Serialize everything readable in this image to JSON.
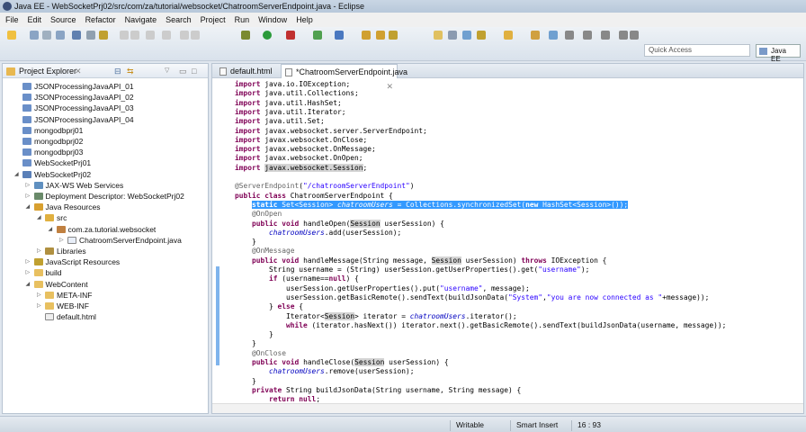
{
  "window": {
    "title": "Java EE - WebSocketPrj02/src/com/za/tutorial/websocket/ChatroomServerEndpoint.java - Eclipse"
  },
  "menu": [
    "File",
    "Edit",
    "Source",
    "Refactor",
    "Navigate",
    "Search",
    "Project",
    "Run",
    "Window",
    "Help"
  ],
  "toolbar": {
    "quick_access_placeholder": "Quick Access",
    "perspective": "Java EE"
  },
  "explorer": {
    "title": "Project Explorer",
    "items": [
      {
        "label": "JSONProcessingJavaAPI_01",
        "depth": 0,
        "icon": "project-folder-icon",
        "twisty": ""
      },
      {
        "label": "JSONProcessingJavaAPI_02",
        "depth": 0,
        "icon": "project-folder-icon",
        "twisty": ""
      },
      {
        "label": "JSONProcessingJavaAPI_03",
        "depth": 0,
        "icon": "project-folder-icon",
        "twisty": ""
      },
      {
        "label": "JSONProcessingJavaAPI_04",
        "depth": 0,
        "icon": "project-folder-icon",
        "twisty": ""
      },
      {
        "label": "mongodbprj01",
        "depth": 0,
        "icon": "project-folder-icon",
        "twisty": ""
      },
      {
        "label": "mongodbprj02",
        "depth": 0,
        "icon": "project-folder-icon",
        "twisty": ""
      },
      {
        "label": "mongodbprj03",
        "depth": 0,
        "icon": "project-folder-icon",
        "twisty": ""
      },
      {
        "label": "WebSocketPrj01",
        "depth": 0,
        "icon": "project-folder-icon",
        "twisty": ""
      },
      {
        "label": "WebSocketPrj02",
        "depth": 0,
        "icon": "web-project-icon",
        "twisty": "open"
      },
      {
        "label": "JAX-WS Web Services",
        "depth": 1,
        "icon": "web-services-icon",
        "twisty": "closed"
      },
      {
        "label": "Deployment Descriptor: WebSocketPrj02",
        "depth": 1,
        "icon": "deployment-descriptor-icon",
        "twisty": "closed"
      },
      {
        "label": "Java Resources",
        "depth": 1,
        "icon": "java-resources-icon",
        "twisty": "open"
      },
      {
        "label": "src",
        "depth": 2,
        "icon": "source-folder-icon",
        "twisty": "open"
      },
      {
        "label": "com.za.tutorial.websocket",
        "depth": 3,
        "icon": "package-icon",
        "twisty": "open"
      },
      {
        "label": "ChatroomServerEndpoint.java",
        "depth": 4,
        "icon": "java-file-icon",
        "twisty": "closed"
      },
      {
        "label": "Libraries",
        "depth": 2,
        "icon": "libraries-icon",
        "twisty": "closed"
      },
      {
        "label": "JavaScript Resources",
        "depth": 1,
        "icon": "javascript-resources-icon",
        "twisty": "closed"
      },
      {
        "label": "build",
        "depth": 1,
        "icon": "folder-icon",
        "twisty": "closed"
      },
      {
        "label": "WebContent",
        "depth": 1,
        "icon": "folder-icon",
        "twisty": "open"
      },
      {
        "label": "META-INF",
        "depth": 2,
        "icon": "folder-icon",
        "twisty": "closed"
      },
      {
        "label": "WEB-INF",
        "depth": 2,
        "icon": "folder-icon",
        "twisty": "closed"
      },
      {
        "label": "default.html",
        "depth": 2,
        "icon": "html-file-icon",
        "twisty": ""
      }
    ]
  },
  "editor": {
    "tabs": [
      {
        "label": "default.html",
        "active": false
      },
      {
        "label": "*ChatroomServerEndpoint.java",
        "active": true
      }
    ],
    "selected_line": 14,
    "lines": [
      "import java.io.IOException;",
      "import java.util.Collections;",
      "import java.util.HashSet;",
      "import java.util.Iterator;",
      "import java.util.Set;",
      "import javax.websocket.server.ServerEndpoint;",
      "import javax.websocket.OnClose;",
      "import javax.websocket.OnMessage;",
      "import javax.websocket.OnOpen;",
      "import javax.websocket.Session;",
      "",
      "@ServerEndpoint(\"/chatroomServerEndpoint\")",
      "public class ChatroomServerEndpoint {",
      "    static Set<Session> chatroomUsers = Collections.synchronizedSet(new HashSet<Session>());",
      "    @OnOpen",
      "    public void handleOpen(Session userSession) {",
      "        chatroomUsers.add(userSession);",
      "    }",
      "    @OnMessage",
      "    public void handleMessage(String message, Session userSession) throws IOException {",
      "        String username = (String) userSession.getUserProperties().get(\"username\");",
      "        if (username==null) {",
      "            userSession.getUserProperties().put(\"username\", message);",
      "            userSession.getBasicRemote().sendText(buildJsonData(\"System\",\"you are now connected as \"+message));",
      "        } else {",
      "            Iterator<Session> iterator = chatroomUsers.iterator();",
      "            while (iterator.hasNext()) iterator.next().getBasicRemote().sendText(buildJsonData(username, message));",
      "        }",
      "    }",
      "    @OnClose",
      "    public void handleClose(Session userSession) {",
      "        chatroomUsers.remove(userSession);",
      "    }",
      "    private String buildJsonData(String username, String message) {",
      "        return null;"
    ]
  },
  "status": {
    "writable": "Writable",
    "insert_mode": "Smart Insert",
    "position": "16 : 93"
  },
  "colors": {
    "keyword": "#7f0055",
    "string": "#2a00ff",
    "annotation": "#646464",
    "field": "#0000c0",
    "selection": "#3399ff"
  }
}
